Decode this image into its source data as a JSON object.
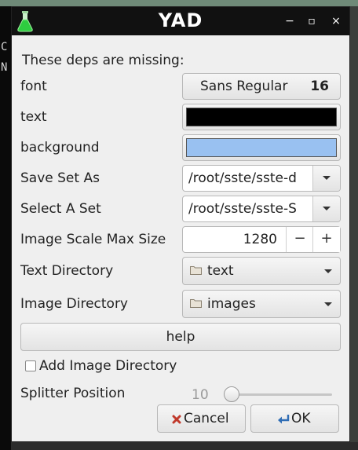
{
  "terminal": {
    "chars": [
      "C",
      "N"
    ]
  },
  "window": {
    "title": "YAD",
    "minimize_glyph": "−",
    "maximize_glyph": "▫",
    "close_glyph": "×"
  },
  "dialog": {
    "header": "These deps are missing:",
    "font": {
      "label": "font",
      "family": "Sans Regular",
      "size": "16"
    },
    "text": {
      "label": "text",
      "color": "#000000"
    },
    "background": {
      "label": "background",
      "color": "#99c1f1"
    },
    "save_set": {
      "label": "Save Set As",
      "value": "/root/sste/sste-d"
    },
    "select_set": {
      "label": "Select A Set",
      "value": "/root/sste/sste-S"
    },
    "image_scale": {
      "label": "Image Scale Max Size",
      "value": "1280",
      "minus": "−",
      "plus": "+"
    },
    "text_dir": {
      "label": "Text Directory",
      "value": "text"
    },
    "image_dir": {
      "label": "Image Directory",
      "value": "images"
    },
    "help_label": "help",
    "add_image_dir": {
      "label": "Add Image Directory",
      "checked": false
    },
    "splitter": {
      "label": "Splitter Position",
      "value": "10",
      "fraction": 0.0
    },
    "cancel_label": "Cancel",
    "ok_label": "OK"
  }
}
